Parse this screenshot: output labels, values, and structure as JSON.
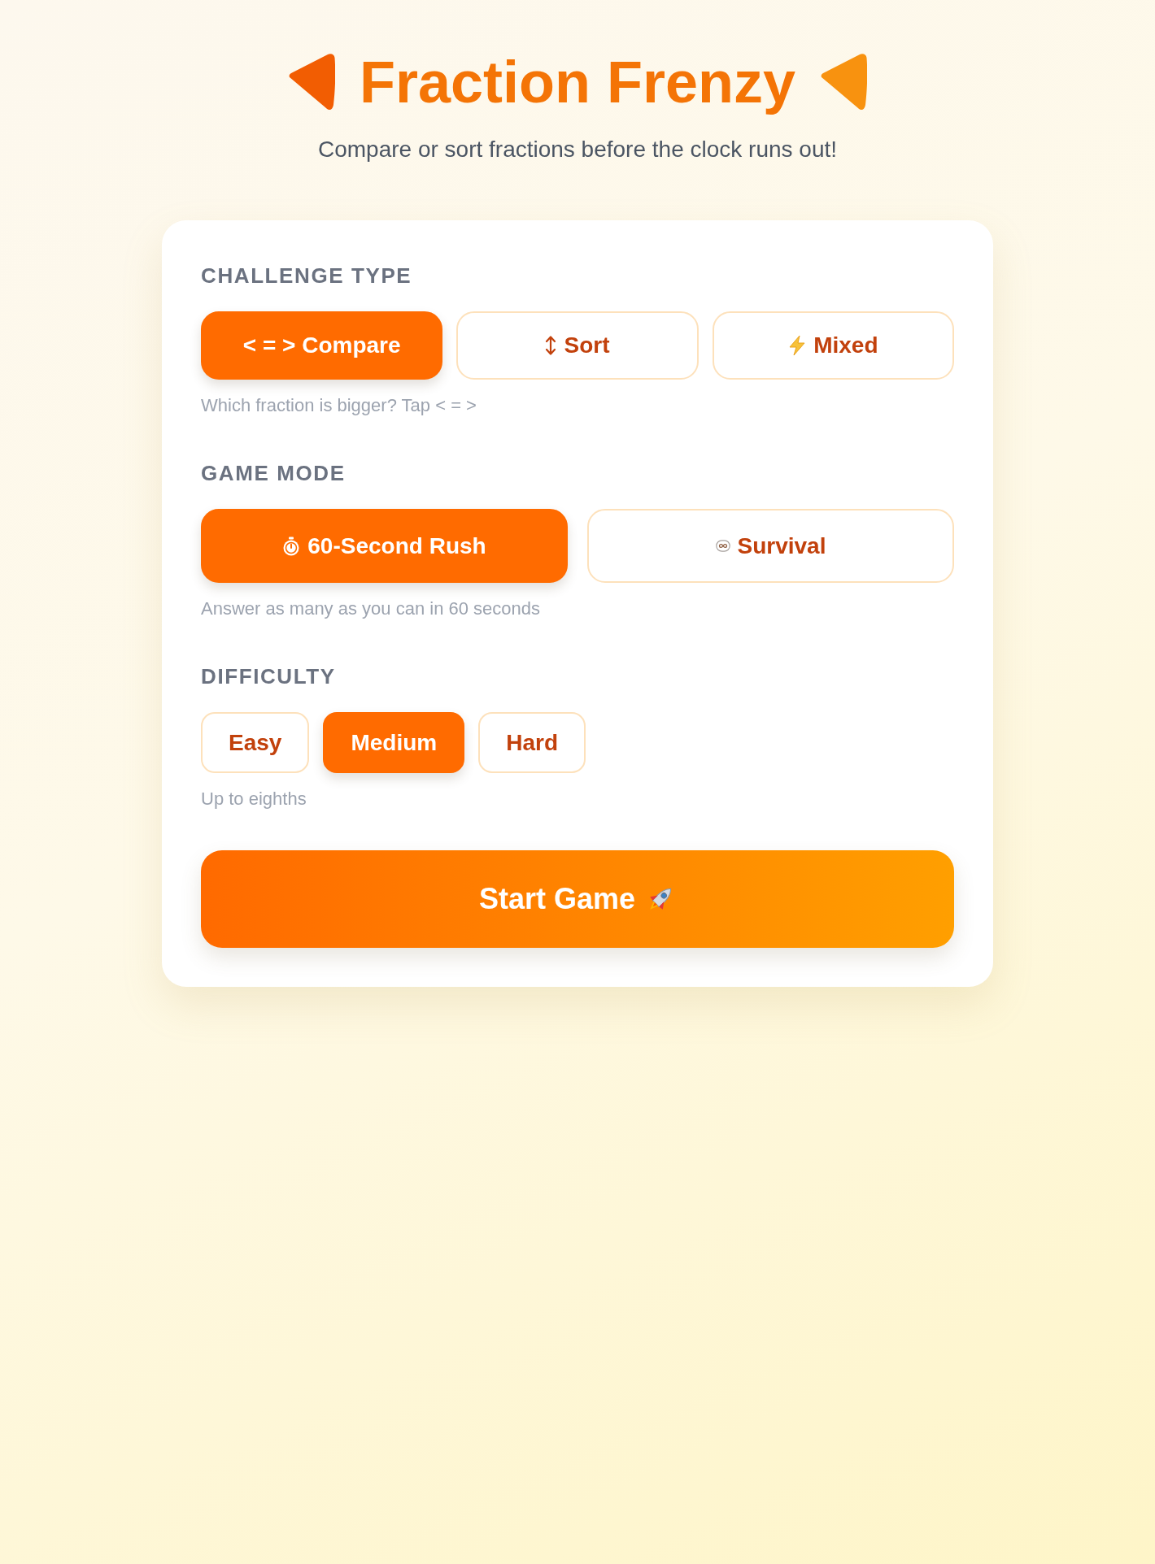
{
  "header": {
    "title": "Fraction Frenzy",
    "subtitle": "Compare or sort fractions before the clock runs out!"
  },
  "sections": [
    {
      "heading": "CHALLENGE TYPE",
      "options": [
        {
          "label": "< = > Compare",
          "selected": true
        },
        {
          "label": "Sort",
          "selected": false
        },
        {
          "label": "Mixed",
          "selected": false
        }
      ],
      "hint": "Which fraction is bigger? Tap < = >"
    },
    {
      "heading": "GAME MODE",
      "options": [
        {
          "label": "60-Second Rush",
          "selected": true
        },
        {
          "label": "Survival",
          "selected": false
        }
      ],
      "hint": "Answer as many as you can in 60 seconds"
    },
    {
      "heading": "DIFFICULTY",
      "options": [
        {
          "label": "Easy",
          "selected": false
        },
        {
          "label": "Medium",
          "selected": true
        },
        {
          "label": "Hard",
          "selected": false
        }
      ],
      "hint": "Up to eighths"
    }
  ],
  "start_button": {
    "label": "Start Game"
  }
}
